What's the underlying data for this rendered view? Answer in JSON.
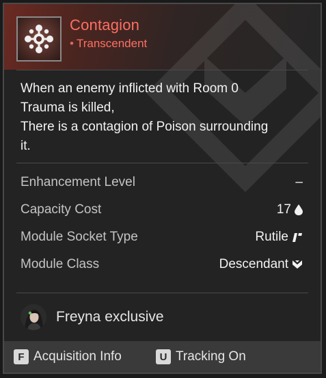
{
  "module": {
    "name": "Contagion",
    "tier": "Transcendent",
    "icon": "contagion-module-icon",
    "description_lines": [
      "When an enemy inflicted with Room 0",
      "Trauma is killed,",
      "There is a contagion of Poison surrounding",
      "it."
    ]
  },
  "stats": [
    {
      "label": "Enhancement Level",
      "value": "–",
      "icon": ""
    },
    {
      "label": "Capacity Cost",
      "value": "17",
      "icon": "capacity-drop-icon"
    },
    {
      "label": "Module Socket Type",
      "value": "Rutile",
      "icon": "rutile-socket-icon"
    },
    {
      "label": "Module Class",
      "value": "Descendant",
      "icon": "descendant-class-icon"
    }
  ],
  "owner": {
    "text": "Freyna exclusive",
    "avatar": "freyna-avatar"
  },
  "footer": {
    "acquisition": {
      "key": "F",
      "label": "Acquisition Info"
    },
    "tracking": {
      "key": "U",
      "label": "Tracking On"
    }
  },
  "colors": {
    "title": "#ff6f63",
    "header_gradient_start": "#6b2a22",
    "panel": "#232323",
    "footer": "#3a3a3a"
  }
}
